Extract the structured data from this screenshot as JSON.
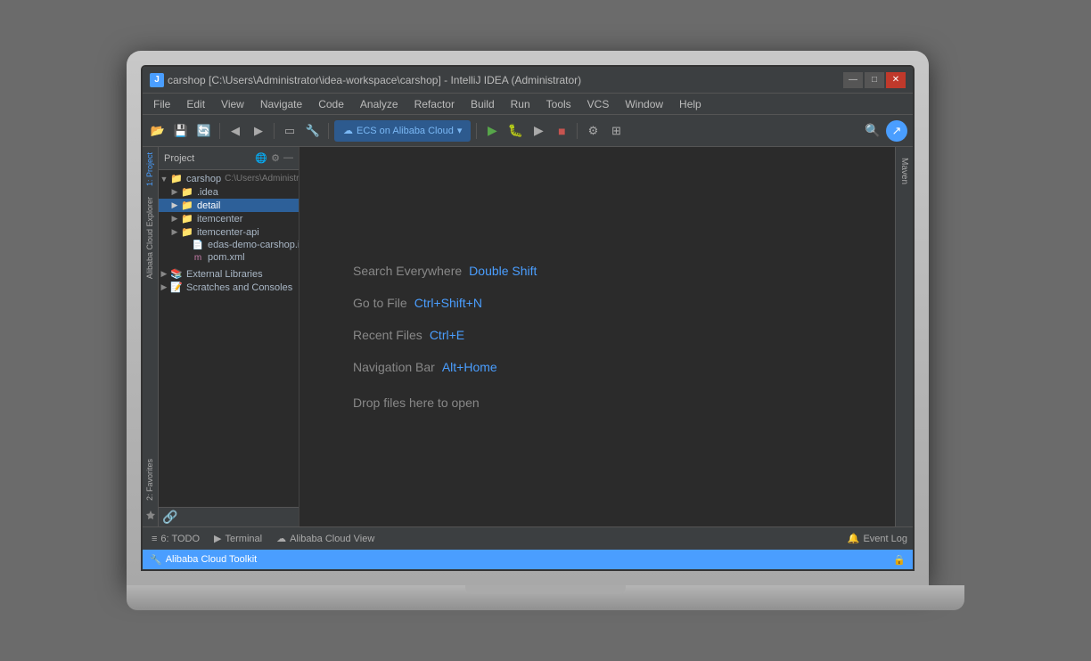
{
  "window": {
    "title": "carshop [C:\\Users\\Administrator\\idea-workspace\\carshop] - IntelliJ IDEA (Administrator)",
    "title_icon": "J",
    "minimize_label": "—",
    "maximize_label": "□",
    "close_label": "✕"
  },
  "menu": {
    "items": [
      "File",
      "Edit",
      "View",
      "Navigate",
      "Code",
      "Analyze",
      "Refactor",
      "Build",
      "Run",
      "Tools",
      "VCS",
      "Window",
      "Help"
    ]
  },
  "toolbar": {
    "cloud_btn": "ECS on Alibaba Cloud",
    "cloud_dropdown": "▾"
  },
  "project_panel": {
    "title": "Project",
    "root": {
      "name": "carshop",
      "path": "C:\\Users\\Administrator\\idea-worksp...",
      "children": [
        {
          "name": ".idea",
          "type": "folder",
          "depth": 1,
          "expanded": false
        },
        {
          "name": "detail",
          "type": "folder",
          "depth": 1,
          "expanded": false,
          "selected": true
        },
        {
          "name": "itemcenter",
          "type": "folder",
          "depth": 1,
          "expanded": false
        },
        {
          "name": "itemcenter-api",
          "type": "folder",
          "depth": 1,
          "expanded": false
        },
        {
          "name": "edas-demo-carshop.iml",
          "type": "iml",
          "depth": 2
        },
        {
          "name": "pom.xml",
          "type": "xml",
          "depth": 2
        }
      ]
    },
    "external_libraries": "External Libraries",
    "scratches": "Scratches and Consoles"
  },
  "welcome": {
    "search_label": "Search Everywhere",
    "search_shortcut": "Double Shift",
    "goto_label": "Go to File",
    "goto_shortcut": "Ctrl+Shift+N",
    "recent_label": "Recent Files",
    "recent_shortcut": "Ctrl+E",
    "nav_label": "Navigation Bar",
    "nav_shortcut": "Alt+Home",
    "drop_label": "Drop files here to open"
  },
  "bottom_tabs": [
    {
      "icon": "≡",
      "label": "6: TODO"
    },
    {
      "icon": "▶",
      "label": "Terminal"
    },
    {
      "icon": "☁",
      "label": "Alibaba Cloud View"
    }
  ],
  "bottom_right": {
    "event_log": "Event Log"
  },
  "status_bar": {
    "left": "Alibaba Cloud Toolkit",
    "lock_icon": "🔒"
  },
  "side_panel_tabs": {
    "left": [
      "1: Project",
      "Alibaba Cloud Explorer",
      "2: Favorites"
    ],
    "right": [
      "Maven"
    ]
  },
  "colors": {
    "accent_blue": "#4a9eff",
    "selected_bg": "#2d6099",
    "toolbar_bg": "#3c3f41",
    "editor_bg": "#2b2b2b",
    "status_bar_bg": "#4a9eff",
    "run_green": "#57a64a",
    "debug_blue": "#5e9bca",
    "stop_red": "#c75450"
  }
}
